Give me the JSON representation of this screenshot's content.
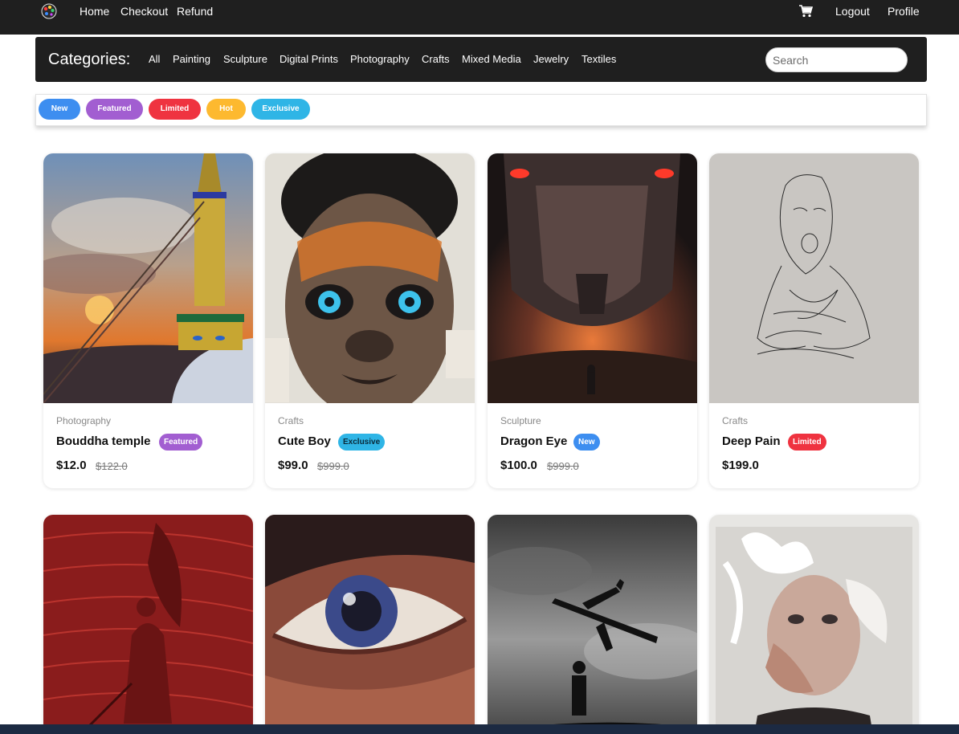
{
  "nav": {
    "links": [
      "Home",
      "Checkout",
      "Refund"
    ],
    "right_links": [
      "Logout",
      "Profile"
    ],
    "cart_icon": "cart-icon",
    "logo_icon": "palette-logo-icon"
  },
  "categories": {
    "title": "Categories:",
    "items": [
      "All",
      "Painting",
      "Sculpture",
      "Digital Prints",
      "Photography",
      "Crafts",
      "Mixed Media",
      "Jewelry",
      "Textiles"
    ],
    "search_placeholder": "Search"
  },
  "tags": [
    {
      "label": "New",
      "color": "#3d8ef0"
    },
    {
      "label": "Featured",
      "color": "#a25ed1"
    },
    {
      "label": "Limited",
      "color": "#ef3340"
    },
    {
      "label": "Hot",
      "color": "#fdb92f"
    },
    {
      "label": "Exclusive",
      "color": "#2fb5e6"
    }
  ],
  "products": [
    {
      "category": "Photography",
      "title": "Bouddha temple",
      "badge": "Featured",
      "badge_color": "#a25ed1",
      "price": "$12.0",
      "old_price": "$122.0",
      "image": "stupa-at-sunset"
    },
    {
      "category": "Crafts",
      "title": "Cute Boy",
      "badge": "Exclusive",
      "badge_color": "#2fb5e6",
      "price": "$99.0",
      "old_price": "$999.0",
      "image": "child-portrait-collage"
    },
    {
      "category": "Sculpture",
      "title": "Dragon Eye",
      "badge": "New",
      "badge_color": "#3d8ef0",
      "price": "$100.0",
      "old_price": "$999.0",
      "image": "dragon-and-warrior"
    },
    {
      "category": "Crafts",
      "title": "Deep Pain",
      "badge": "Limited",
      "badge_color": "#ef3340",
      "price": "$199.0",
      "old_price": "",
      "image": "ink-sketch-screaming-face"
    },
    {
      "category": "",
      "title": "",
      "badge": "",
      "badge_color": "",
      "price": "",
      "old_price": "",
      "image": "red-angel-etching"
    },
    {
      "category": "",
      "title": "",
      "badge": "",
      "badge_color": "",
      "price": "",
      "old_price": "",
      "image": "painted-eye"
    },
    {
      "category": "",
      "title": "",
      "badge": "",
      "badge_color": "",
      "price": "",
      "old_price": "",
      "image": "child-and-airplane-silhouette"
    },
    {
      "category": "",
      "title": "",
      "badge": "",
      "badge_color": "",
      "price": "",
      "old_price": "",
      "image": "torn-paper-woman-portrait"
    }
  ]
}
